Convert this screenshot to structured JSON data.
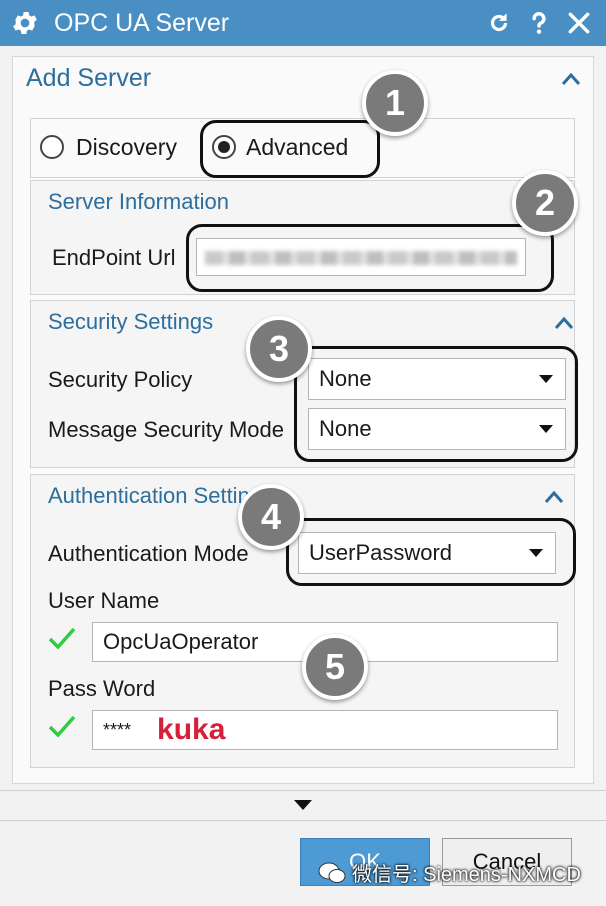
{
  "window": {
    "title": "OPC UA Server"
  },
  "add_server": {
    "title": "Add Server",
    "modes": [
      {
        "label": "Discovery",
        "selected": false
      },
      {
        "label": "Advanced",
        "selected": true
      }
    ]
  },
  "server_information": {
    "title": "Server Information",
    "endpoint_label": "EndPoint Url"
  },
  "security_settings": {
    "title": "Security Settings",
    "policy_label": "Security Policy",
    "policy_value": "None",
    "message_mode_label": "Message Security Mode",
    "message_mode_value": "None"
  },
  "authentication": {
    "title": "Authentication Settings",
    "mode_label": "Authentication Mode",
    "mode_value": "UserPassword",
    "username_label": "User Name",
    "username_value": "OpcUaOperator",
    "password_label": "Pass Word",
    "password_value": "****",
    "password_annotation": "kuka"
  },
  "footer": {
    "ok_label": "OK",
    "cancel_label": "Cancel",
    "watermark": "微信号: Siemens-NXMCD"
  },
  "badges": [
    "1",
    "2",
    "3",
    "4",
    "5"
  ],
  "colors": {
    "titlebar": "#4a8fc4",
    "section_title": "#2c6e9e",
    "badge": "#7a7a7a",
    "check": "#2ecc40",
    "annotation": "#d6203a",
    "ok_button": "#4e9ad4"
  }
}
